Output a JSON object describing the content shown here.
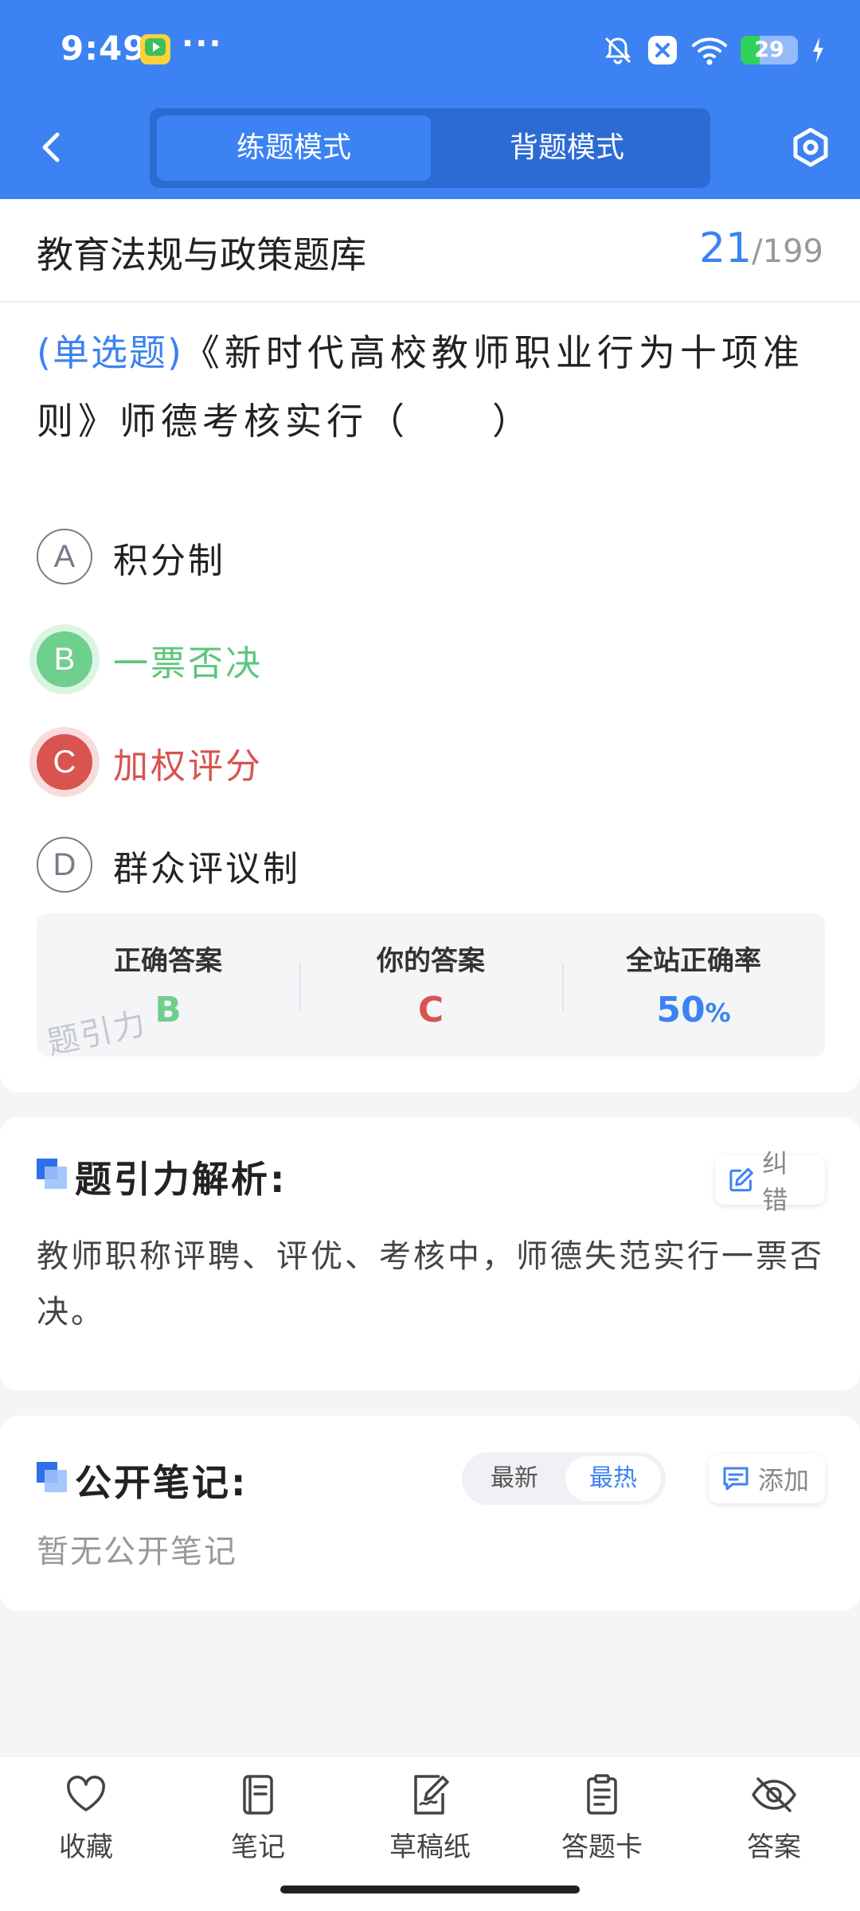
{
  "status_bar": {
    "time": "9:49",
    "dots": "···",
    "battery": "29"
  },
  "nav": {
    "tabs": [
      {
        "label": "练题模式",
        "active": true
      },
      {
        "label": "背题模式",
        "active": false
      }
    ]
  },
  "question_bank": {
    "title": "教育法规与政策题库",
    "current": "21",
    "separator": "/",
    "total": "199"
  },
  "question": {
    "type": "(单选题)",
    "text": "《新时代高校教师职业行为十项准则》师德考核实行（　　）"
  },
  "options": [
    {
      "letter": "A",
      "text": "积分制",
      "state": "normal"
    },
    {
      "letter": "B",
      "text": "一票否决",
      "state": "correct"
    },
    {
      "letter": "C",
      "text": "加权评分",
      "state": "wrong"
    },
    {
      "letter": "D",
      "text": "群众评议制",
      "state": "normal"
    }
  ],
  "result": {
    "correct_label": "正确答案",
    "correct_value": "B",
    "yours_label": "你的答案",
    "yours_value": "C",
    "rate_label": "全站正确率",
    "rate_value": "50",
    "rate_unit": "%",
    "watermark": "题引力"
  },
  "analysis": {
    "title": "题引力解析:",
    "report_label": "纠错",
    "text": "教师职称评聘、评优、考核中，师德失范实行一票否决。"
  },
  "notes": {
    "title": "公开笔记:",
    "sort_latest": "最新",
    "sort_hottest": "最热",
    "add_label": "添加",
    "empty_text": "暂无公开笔记"
  },
  "toolbar": {
    "items": [
      {
        "label": "收藏",
        "icon": "heart-icon"
      },
      {
        "label": "笔记",
        "icon": "notebook-icon"
      },
      {
        "label": "草稿纸",
        "icon": "draft-paper-icon"
      },
      {
        "label": "答题卡",
        "icon": "answer-sheet-icon"
      },
      {
        "label": "答案",
        "icon": "eye-off-icon"
      }
    ]
  },
  "colors": {
    "brand_blue": "#3c82f2",
    "correct_green": "#6fcf8c",
    "wrong_red": "#d9534f"
  }
}
